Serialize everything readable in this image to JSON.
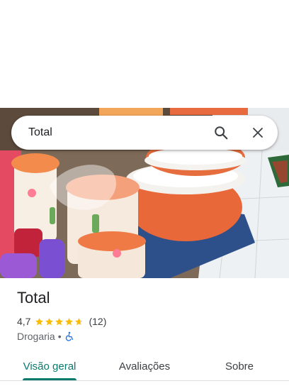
{
  "search": {
    "query": "Total"
  },
  "place": {
    "name": "Total",
    "rating_text": "4,7",
    "rating_value": 4.7,
    "rating_max": 5,
    "review_count": "(12)",
    "category": "Drogaria",
    "separator": "•"
  },
  "tabs": [
    {
      "label": "Visão geral",
      "active": true
    },
    {
      "label": "Avaliações",
      "active": false
    },
    {
      "label": "Sobre",
      "active": false
    }
  ],
  "colors": {
    "accent": "#0a7a6c",
    "star": "#fbbc04",
    "accessibility": "#1a73e8"
  },
  "icons": {
    "search": "search-icon",
    "close": "close-icon",
    "star": "star-icon",
    "accessibility": "wheelchair-icon"
  }
}
